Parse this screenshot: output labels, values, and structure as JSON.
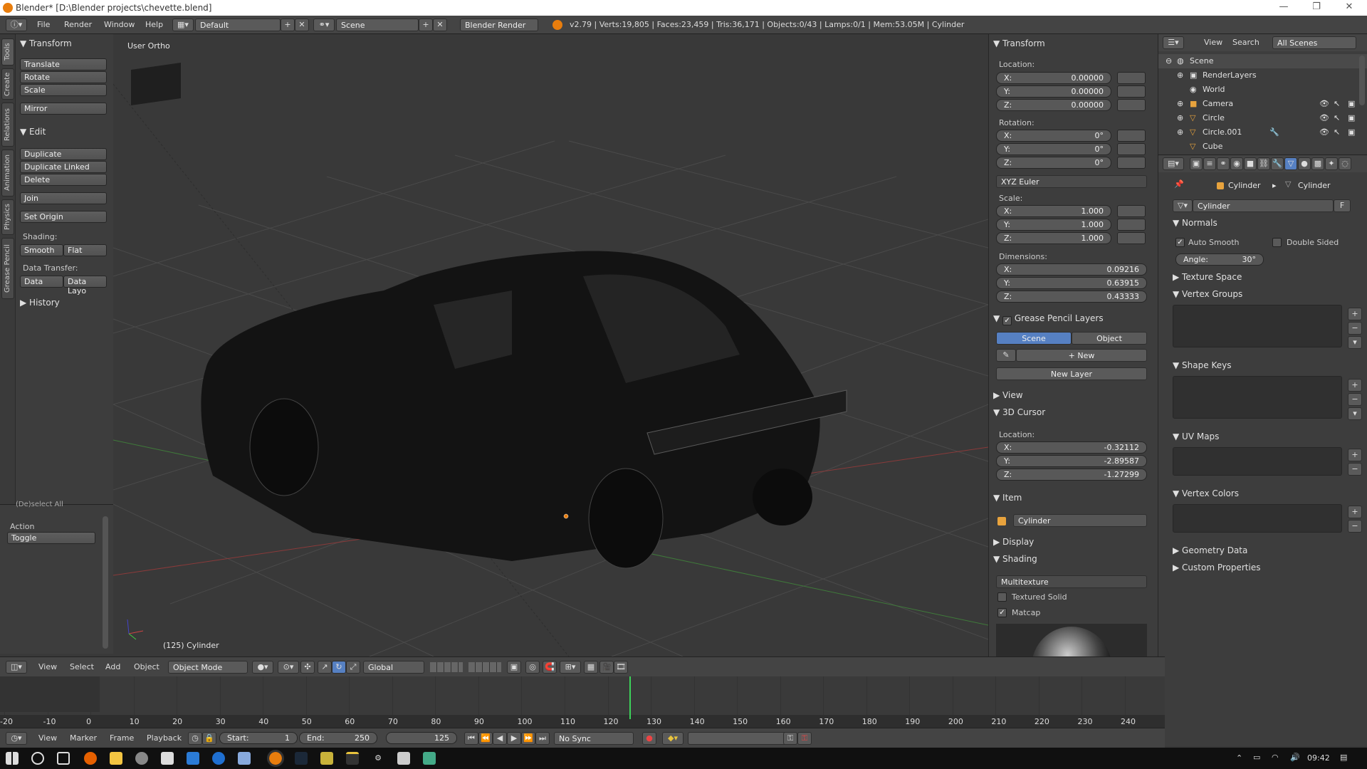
{
  "window": {
    "title": "Blender* [D:\\Blender projects\\chevette.blend]",
    "controls": [
      "—",
      "❐",
      "✕"
    ]
  },
  "info_header": {
    "menus": [
      "File",
      "Render",
      "Window",
      "Help"
    ],
    "layout": "Default",
    "scene": "Scene",
    "engine": "Blender Render",
    "stats": "v2.79 | Verts:19,805 | Faces:23,459 | Tris:36,171 | Objects:0/43 | Lamps:0/1 | Mem:53.05M | Cylinder"
  },
  "tool_tabs": [
    "Tools",
    "Create",
    "Relations",
    "Animation",
    "Physics",
    "Grease Pencil"
  ],
  "tool_shelf": {
    "transform": {
      "title": "Transform",
      "buttons": [
        "Translate",
        "Rotate",
        "Scale",
        "Mirror"
      ]
    },
    "edit": {
      "title": "Edit",
      "buttons": [
        "Duplicate",
        "Duplicate Linked",
        "Delete",
        "Join"
      ],
      "set_origin": "Set Origin",
      "shading_label": "Shading:",
      "smooth": "Smooth",
      "flat": "Flat",
      "data_transfer_label": "Data Transfer:",
      "data": "Data",
      "data_layout": "Data Layo"
    },
    "history": "History"
  },
  "operator": {
    "cut": "(De)select All",
    "action_label": "Action",
    "action_value": "Toggle"
  },
  "viewport": {
    "view_label": "User Ortho",
    "object_label": "(125) Cylinder"
  },
  "n_panel": {
    "transform_title": "Transform",
    "location_label": "Location:",
    "location": [
      {
        "a": "X:",
        "v": "0.00000"
      },
      {
        "a": "Y:",
        "v": "0.00000"
      },
      {
        "a": "Z:",
        "v": "0.00000"
      }
    ],
    "rotation_label": "Rotation:",
    "rotation": [
      {
        "a": "X:",
        "v": "0°"
      },
      {
        "a": "Y:",
        "v": "0°"
      },
      {
        "a": "Z:",
        "v": "0°"
      }
    ],
    "rotation_mode": "XYZ Euler",
    "scale_label": "Scale:",
    "scale": [
      {
        "a": "X:",
        "v": "1.000"
      },
      {
        "a": "Y:",
        "v": "1.000"
      },
      {
        "a": "Z:",
        "v": "1.000"
      }
    ],
    "dimensions_label": "Dimensions:",
    "dimensions": [
      {
        "a": "X:",
        "v": "0.09216"
      },
      {
        "a": "Y:",
        "v": "0.63915"
      },
      {
        "a": "Z:",
        "v": "0.43333"
      }
    ],
    "grease_title": "Grease Pencil Layers",
    "gp_scene": "Scene",
    "gp_object": "Object",
    "gp_new": "New",
    "gp_new_layer": "New Layer",
    "view_title": "View",
    "cursor_title": "3D Cursor",
    "cursor_location_label": "Location:",
    "cursor": [
      {
        "a": "X:",
        "v": "-0.32112"
      },
      {
        "a": "Y:",
        "v": "-2.89587"
      },
      {
        "a": "Z:",
        "v": "-1.27299"
      }
    ],
    "item_title": "Item",
    "item_name": "Cylinder",
    "display_title": "Display",
    "shading_title": "Shading",
    "shading_mode": "Multitexture",
    "textured_solid": "Textured Solid",
    "matcap": "Matcap"
  },
  "outliner": {
    "view": "View",
    "search": "Search",
    "filter": "All Scenes",
    "items": [
      "Scene",
      "RenderLayers",
      "World",
      "Camera",
      "Circle",
      "Circle.001",
      "Cube"
    ]
  },
  "properties": {
    "crumb1": "Cylinder",
    "crumb2": "Cylinder",
    "mesh_name": "Cylinder",
    "fake_user": "F",
    "normals_title": "Normals",
    "auto_smooth": "Auto Smooth",
    "double_sided": "Double Sided",
    "angle_label": "Angle:",
    "angle_value": "30°",
    "texture_space": "Texture Space",
    "vertex_groups": "Vertex Groups",
    "shape_keys": "Shape Keys",
    "uv_maps": "UV Maps",
    "vertex_colors": "Vertex Colors",
    "geometry_data": "Geometry Data",
    "custom_properties": "Custom Properties"
  },
  "view3d_header": {
    "menus": [
      "View",
      "Select",
      "Add",
      "Object"
    ],
    "mode": "Object Mode",
    "orientation": "Global"
  },
  "timeline": {
    "ticks": [
      "-20",
      "-10",
      "0",
      "10",
      "20",
      "30",
      "40",
      "50",
      "60",
      "70",
      "80",
      "90",
      "100",
      "110",
      "120",
      "130",
      "140",
      "150",
      "160",
      "170",
      "180",
      "190",
      "200",
      "210",
      "220",
      "230",
      "240"
    ],
    "current_frame": 125,
    "menus": [
      "View",
      "Marker",
      "Frame",
      "Playback"
    ],
    "start": "Start:",
    "start_val": "1",
    "end": "End:",
    "end_val": "250",
    "current": "125",
    "sync": "No Sync"
  },
  "taskbar": {
    "time": "09:42"
  },
  "colors": {
    "accent": "#5680c2",
    "blender_orange": "#e87d0d",
    "frame_line": "#3cd35a"
  }
}
